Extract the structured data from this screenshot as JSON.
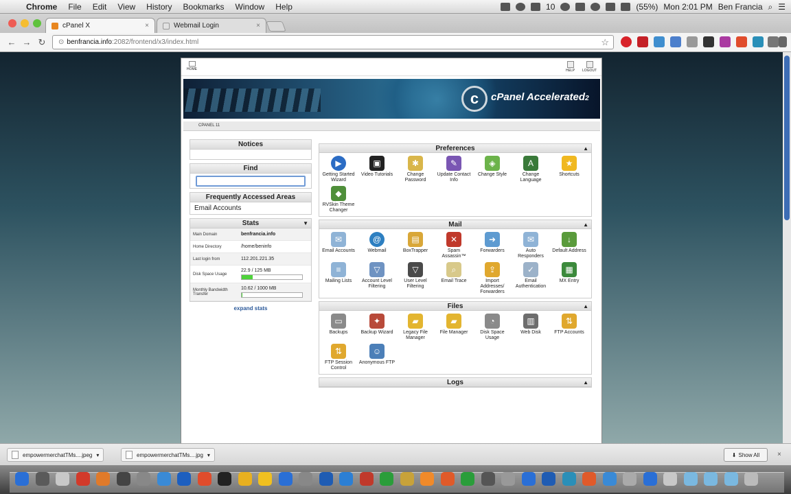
{
  "menubar": {
    "items": [
      "Chrome",
      "File",
      "Edit",
      "View",
      "History",
      "Bookmarks",
      "Window",
      "Help"
    ],
    "battery": "(55%)",
    "clock": "Mon 2:01 PM",
    "user": "Ben Francia",
    "tray_count": "10"
  },
  "tabs": [
    {
      "label": "cPanel X",
      "close": "×"
    },
    {
      "label": "Webmail Login",
      "close": "×"
    }
  ],
  "address": {
    "host": "benfrancia.info",
    "path": ":2082/frontend/x3/index.html"
  },
  "cpanel": {
    "home_label": "HOME",
    "help_label": "HELP",
    "logout_label": "LOGOUT",
    "brand": "cPanel",
    "brand_suffix": "Accelerated",
    "brand_tm": "2",
    "subbar": "CPANEL 11",
    "notices_title": "Notices",
    "find_title": "Find",
    "frequent_title": "Frequently Accessed Areas",
    "frequent_items": [
      "Email Accounts"
    ],
    "stats_title": "Stats",
    "stats": [
      {
        "label": "Main Domain",
        "value": "benfrancia.info"
      },
      {
        "label": "Home Directory",
        "value": "/home/beninfo"
      },
      {
        "label": "Last login from",
        "value": "112.201.221.35"
      },
      {
        "label": "Disk Space Usage",
        "value": "22.9 / 125 MB",
        "fraction": 0.18
      },
      {
        "label": "Monthly Bandwidth Transfer",
        "value": "10.62 / 1000 MB",
        "fraction": 0.01
      }
    ],
    "expand_stats": "expand stats",
    "sections": {
      "preferences": {
        "title": "Preferences",
        "items": [
          "Getting Started Wizard",
          "Video Tutorials",
          "Change Password",
          "Update Contact Info",
          "Change Style",
          "Change Language",
          "Shortcuts",
          "RVSkin Theme Changer"
        ]
      },
      "mail": {
        "title": "Mail",
        "items": [
          "Email Accounts",
          "Webmail",
          "BoxTrapper",
          "Spam Assassin™",
          "Forwarders",
          "Auto Responders",
          "Default Address",
          "Mailing Lists",
          "Account Level Filtering",
          "User Level Filtering",
          "Email Trace",
          "Import Addresses/ Forwarders",
          "Email Authentication",
          "MX Entry"
        ]
      },
      "files": {
        "title": "Files",
        "items": [
          "Backups",
          "Backup Wizard",
          "Legacy File Manager",
          "File Manager",
          "Disk Space Usage",
          "Web Disk",
          "FTP Accounts",
          "FTP Session Control",
          "Anonymous FTP"
        ]
      },
      "logs": {
        "title": "Logs"
      }
    },
    "caret_up": "▲",
    "caret_down": "▼"
  },
  "downloads": {
    "items": [
      "empowermerchatTMs....jpeg",
      "empowermerchatTMs....jpg"
    ],
    "show_all": "Show All",
    "close": "×"
  },
  "colors": {
    "accent": "#3d6db5",
    "usage_fill": "#4fd33b"
  }
}
